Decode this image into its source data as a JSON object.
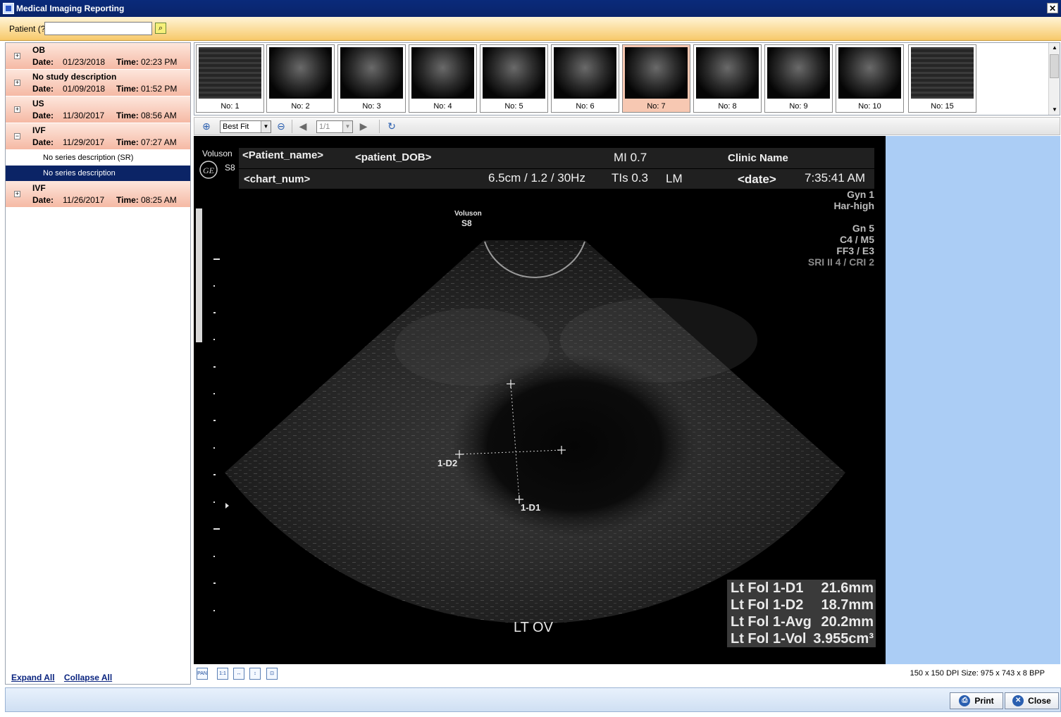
{
  "window": {
    "title": "Medical Imaging Reporting",
    "close_label": "✕"
  },
  "patient_bar": {
    "label": "Patient (?)",
    "value": ""
  },
  "studies": [
    {
      "toggle": "+",
      "description": "OB",
      "date_label": "Date:",
      "date": "01/23/2018",
      "time_label": "Time:",
      "time": "02:23 PM"
    },
    {
      "toggle": "+",
      "description": "No study description",
      "date_label": "Date:",
      "date": "01/09/2018",
      "time_label": "Time:",
      "time": "01:52 PM"
    },
    {
      "toggle": "+",
      "description": "US",
      "date_label": "Date:",
      "date": "11/30/2017",
      "time_label": "Time:",
      "time": "08:56 AM"
    },
    {
      "toggle": "−",
      "description": "IVF",
      "date_label": "Date:",
      "date": "11/29/2017",
      "time_label": "Time:",
      "time": "07:27 AM"
    },
    {
      "toggle": "+",
      "description": "IVF",
      "date_label": "Date:",
      "date": "11/26/2017",
      "time_label": "Time:",
      "time": "08:25 AM"
    }
  ],
  "series": [
    {
      "label": "No series description (SR)"
    },
    {
      "label": "No series description"
    }
  ],
  "tree_links": {
    "expand_all": "Expand All",
    "collapse_all": "Collapse All"
  },
  "thumbnails": [
    "No: 1",
    "No: 2",
    "No: 3",
    "No: 4",
    "No: 5",
    "No: 6",
    "No: 7",
    "No: 8",
    "No: 9",
    "No: 10",
    "No: 15"
  ],
  "selected_thumbnail": "No: 7",
  "toolbar": {
    "zoom_mode": "Best Fit",
    "page": "1/1"
  },
  "ultrasound": {
    "brand": "Voluson",
    "model": "S8",
    "patient_name": "<Patient_name>",
    "patient_dob": "<patient_DOB>",
    "chart_num": "<chart_num>",
    "mi": "MI  0.7",
    "tis": "TIs  0.3",
    "depth_info": "6.5cm / 1.2 / 30Hz",
    "lm": "LM",
    "clinic": "Clinic Name",
    "date": "<date>",
    "time": "7:35:41 AM",
    "settings": [
      "Gyn 1",
      "Har-high",
      "Gn   5",
      "C4 / M5",
      "FF3 / E3",
      "SRI II 4 / CRI 2"
    ],
    "probe_brand": "Voluson",
    "probe_model": "S8",
    "caliper_d1": "1-D1",
    "caliper_d2": "1-D2",
    "region_label": "LT OV",
    "measurements": [
      {
        "name": "Lt Fol 1-D1",
        "value": "21.6mm"
      },
      {
        "name": "Lt Fol 1-D2",
        "value": "18.7mm"
      },
      {
        "name": "Lt Fol 1-Avg",
        "value": "20.2mm"
      },
      {
        "name": "Lt Fol 1-Vol",
        "value": "3.955cm³"
      }
    ]
  },
  "status": {
    "info": "150 x 150 DPI  Size: 975 x 743 x 8 BPP",
    "pan_icon_text": "PAN",
    "one_to_one_text": "1:1"
  },
  "buttons": {
    "print": "Print",
    "close": "Close"
  }
}
